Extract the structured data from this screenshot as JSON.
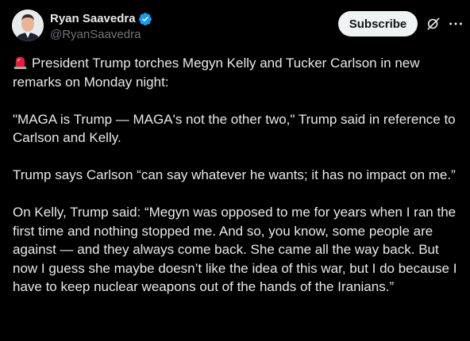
{
  "author": {
    "name": "Ryan Saavedra",
    "handle": "@RyanSaavedra",
    "verified": true
  },
  "actions": {
    "subscribe_label": "Subscribe",
    "grok_icon": "grok-icon",
    "more_icon": "more-icon"
  },
  "tweet": {
    "emoji": "siren-icon",
    "paragraphs": [
      "President Trump torches Megyn Kelly and Tucker Carlson in new remarks on Monday night:",
      "\"MAGA is Trump — MAGA's not the other two,\" Trump said in reference to Carlson and Kelly.",
      "Trump says Carlson “can say whatever he wants; it has no impact on me.”",
      "On Kelly, Trump said: “Megyn was opposed to me for years when I ran the first time and nothing stopped me. And so, you know, some people are against — and they always come back. She came all the way back. But now I guess she maybe doesn’t like the idea of this war, but I do because I have to keep nuclear weapons out of the hands of the Iranians.”"
    ]
  },
  "colors": {
    "background": "#000000",
    "text": "#e7e9ea",
    "secondary": "#71767b",
    "verified": "#1d9bf0",
    "button_bg": "#eff3f4"
  }
}
